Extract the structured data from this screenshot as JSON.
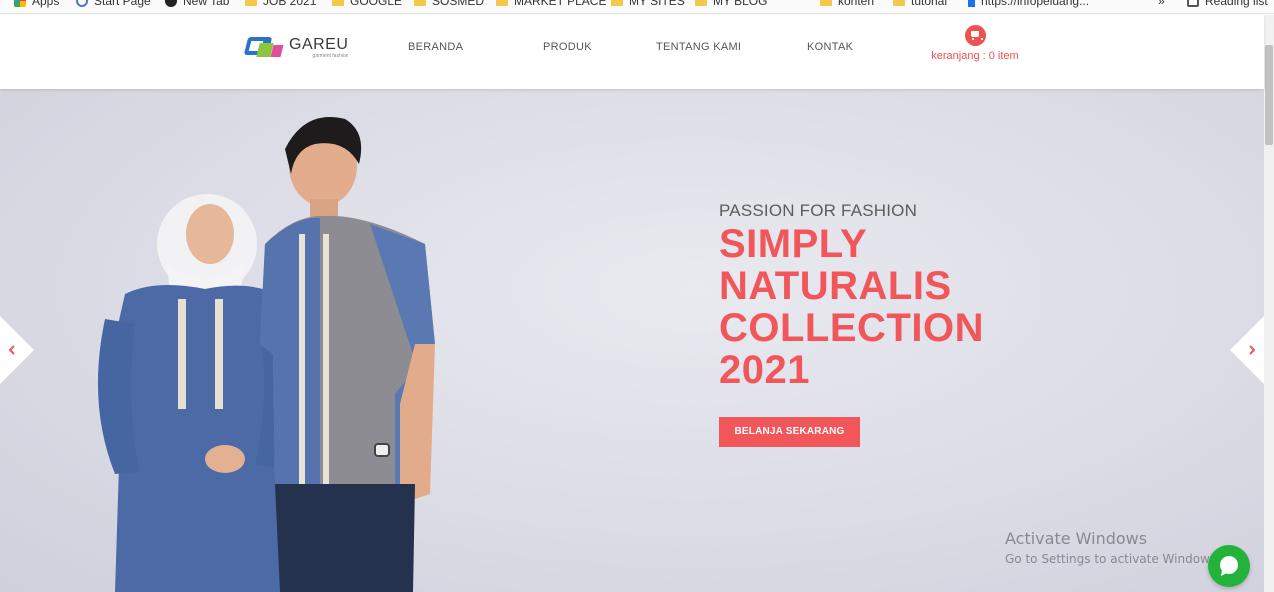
{
  "bookmarks": [
    "Apps",
    "Start Page",
    "New Tab",
    "JOB 2021",
    "GOOGLE",
    "SOSMED",
    "MARKET PLACE",
    "MY SITES",
    "MY BLOG",
    "konten",
    "tutorial",
    "https://infopeluang...",
    "»",
    "Reading list"
  ],
  "logo": {
    "name": "GAREU",
    "tagline": "garment fashion"
  },
  "nav": [
    "BERANDA",
    "PRODUK",
    "TENTANG KAMI",
    "KONTAK"
  ],
  "cart": {
    "label": "keranjang : 0 item",
    "icon": "cart-icon"
  },
  "hero": {
    "subtitle": "PASSION FOR FASHION",
    "title_lines": [
      "SIMPLY",
      "NATURALIS",
      "COLLECTION",
      "2021"
    ],
    "cta": "BELANJA SEKARANG"
  },
  "watermark": {
    "title": "Activate Windows",
    "subtitle": "Go to Settings to activate Windows."
  },
  "colors": {
    "accent": "#f0565a",
    "whatsapp": "#23b33a"
  }
}
